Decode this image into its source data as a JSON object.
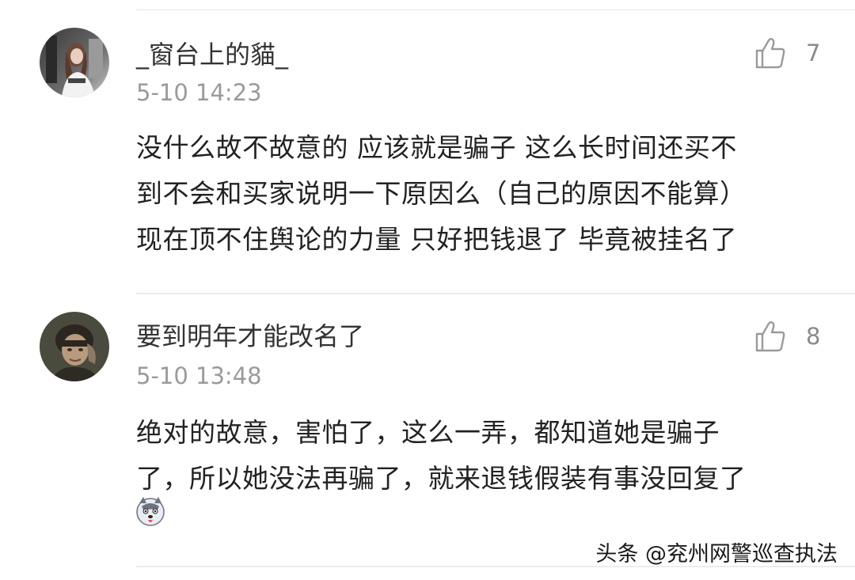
{
  "comments": [
    {
      "username": "_窗台上的貓_",
      "time": "5-10 14:23",
      "likes": "7",
      "body_lines": [
        "没什么故不故意的 应该就是骗子 这么长时间还买不",
        "到不会和买家说明一下原因么（自己的原因不能算）",
        "现在顶不住舆论的力量 只好把钱退了 毕竟被挂名了"
      ],
      "avatar_icon": "avatar-photo-girl-icon",
      "like_icon": "thumbs-up-icon"
    },
    {
      "username": "要到明年才能改名了",
      "time": "5-10 13:48",
      "likes": "8",
      "body_lines": [
        "绝对的故意，害怕了，这么一弄，都知道她是骗子",
        "了，所以她没法再骗了，就来退钱假装有事没回复了"
      ],
      "emoji_icon": "husky-dog-emoji-icon",
      "avatar_icon": "avatar-photo-man-icon",
      "like_icon": "thumbs-up-icon"
    }
  ],
  "watermark": "头条 @兖州网警巡查执法",
  "colors": {
    "text": "#222222",
    "meta": "#9a9a9a",
    "divider": "#ececec"
  }
}
